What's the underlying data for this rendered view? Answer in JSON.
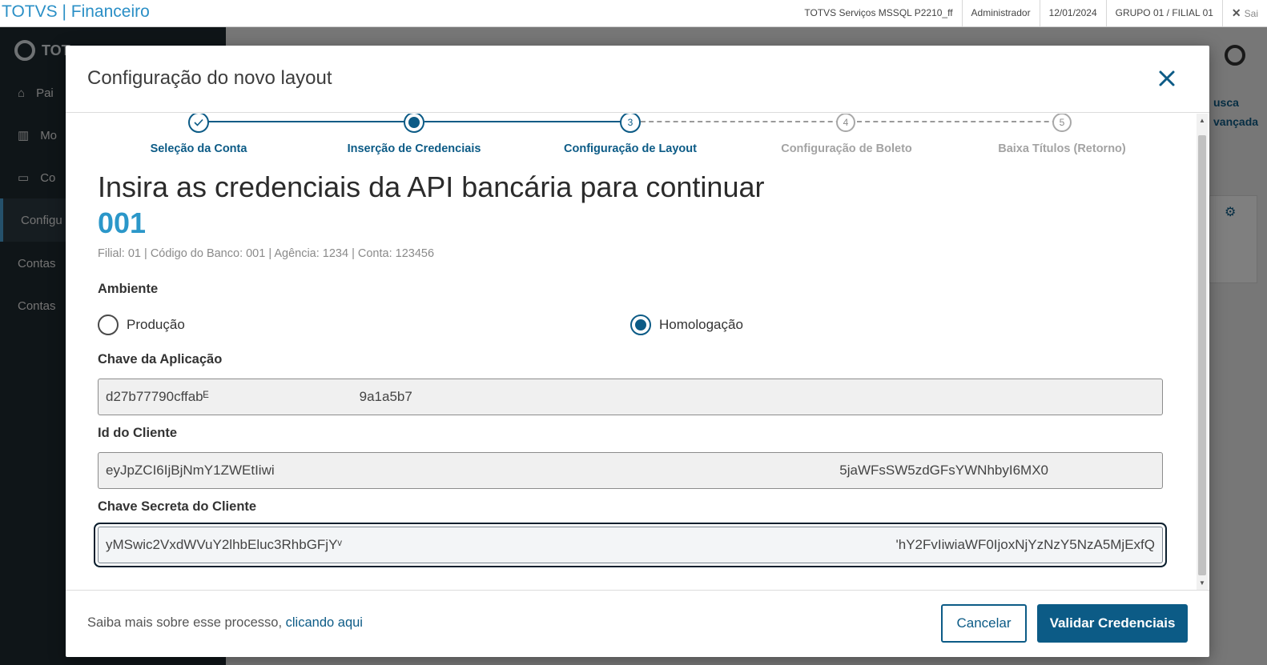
{
  "topbar": {
    "app_title": "TOTVS | Financeiro",
    "server": "TOTVS Serviços MSSQL P2210_ff",
    "user": "Administrador",
    "date": "12/01/2024",
    "branch": "GRUPO 01 / FILIAL 01",
    "exit_label": "Sai"
  },
  "background": {
    "logo_text": "TOT",
    "nav": [
      {
        "label": "Pai",
        "icon": "home-icon"
      },
      {
        "label": "Mo",
        "icon": "chart-icon"
      },
      {
        "label": "Co",
        "icon": "monitor-icon"
      },
      {
        "label": "Configu",
        "icon": ""
      },
      {
        "label": "Contas",
        "icon": ""
      },
      {
        "label": "Contas",
        "icon": ""
      }
    ],
    "right_link_1": "usca",
    "right_link_2": "vançada"
  },
  "modal": {
    "title": "Configuração do novo layout",
    "steps": [
      {
        "number": "✓",
        "label": "Seleção da Conta",
        "state": "done"
      },
      {
        "number": "",
        "label": "Inserção de Credenciais",
        "state": "current"
      },
      {
        "number": "3",
        "label": "Configuração de Layout",
        "state": "next"
      },
      {
        "number": "4",
        "label": "Configuração de Boleto",
        "state": "future"
      },
      {
        "number": "5",
        "label": "Baixa Títulos (Retorno)",
        "state": "future"
      }
    ],
    "heading": "Insira as credenciais da API bancária para continuar",
    "bank_code": "001",
    "bank_info": "Filial: 01 | Código do Banco: 001 | Agência: 1234 | Conta: 123456",
    "environment": {
      "label": "Ambiente",
      "options": [
        {
          "label": "Produção",
          "checked": false
        },
        {
          "label": "Homologação",
          "checked": true
        }
      ]
    },
    "fields": {
      "app_key": {
        "label": "Chave da Aplicação",
        "value_start": "d27b77790cffabᴱ",
        "value_end": "9a1a5b7"
      },
      "client_id": {
        "label": "Id do Cliente",
        "value_start": "eyJpZCI6IjBjNmY1ZWEtIiwi",
        "value_end": "5jaWFsSW5zdGFsYWNhbyI6MX0"
      },
      "client_secret": {
        "label": "Chave Secreta do Cliente",
        "value_start": "yMSwic2VxdWVuY2lhbEluc3RhbGFjYᵛ",
        "value_end": "'hY2FvIiwiaWF0IjoxNjYzNzY5NzA5MjExfQ"
      }
    },
    "footer": {
      "text": "Saiba mais sobre esse processo,",
      "link": "clicando aqui",
      "cancel": "Cancelar",
      "validate": "Validar Credenciais"
    }
  }
}
